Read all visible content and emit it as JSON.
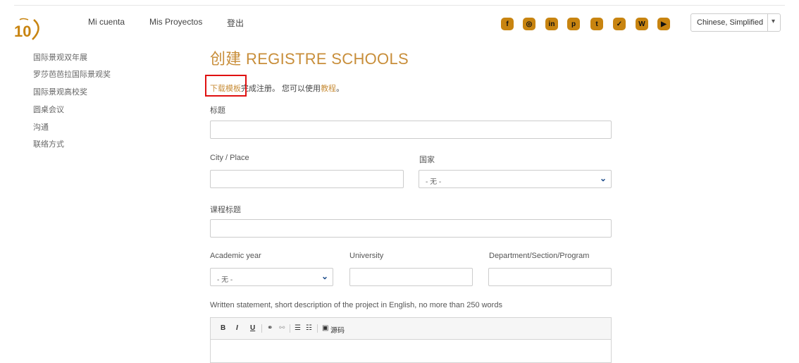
{
  "logo": {
    "text": "10"
  },
  "topnav": {
    "account": "Mi cuenta",
    "projects": "Mis Proyectos",
    "logout": "登出"
  },
  "social": [
    {
      "icon": "facebook-icon",
      "glyph": "f"
    },
    {
      "icon": "instagram-icon",
      "glyph": "◎"
    },
    {
      "icon": "linkedin-icon",
      "glyph": "in"
    },
    {
      "icon": "pinterest-icon",
      "glyph": "p"
    },
    {
      "icon": "tumblr-icon",
      "glyph": "t"
    },
    {
      "icon": "twitter-icon",
      "glyph": "✓"
    },
    {
      "icon": "wordpress-icon",
      "glyph": "W"
    },
    {
      "icon": "youtube-icon",
      "glyph": "▶"
    }
  ],
  "language": {
    "selected": "Chinese, Simplified"
  },
  "sidebar": {
    "items": [
      {
        "label": "国际景观双年展"
      },
      {
        "label": "罗莎芭芭拉国际景观奖"
      },
      {
        "label": "国际景观高校奖"
      },
      {
        "label": "圆桌会议"
      },
      {
        "label": "沟通"
      },
      {
        "label": "联络方式"
      }
    ]
  },
  "form": {
    "title": "创建 REGISTRE SCHOOLS",
    "intro": {
      "link1": "下载模板",
      "text1": "完成注册。 您可以使用",
      "link2": "教程",
      "text2": "。"
    },
    "labels": {
      "title": "标题",
      "city": "City / Place",
      "country": "国家",
      "course_title": "课程标题",
      "academic_year": "Academic year",
      "university": "University",
      "department": "Department/Section/Program",
      "statement": "Written statement, short description of the project in English, no more than 250 words"
    },
    "values": {
      "country": "- 无 -",
      "academic_year": "- 无 -"
    },
    "editor": {
      "bold": "B",
      "italic": "I",
      "underline": "U",
      "source": "源码"
    }
  },
  "colors": {
    "accent": "#c88e3a",
    "social_bg": "#c88410",
    "highlight": "#e01010"
  }
}
